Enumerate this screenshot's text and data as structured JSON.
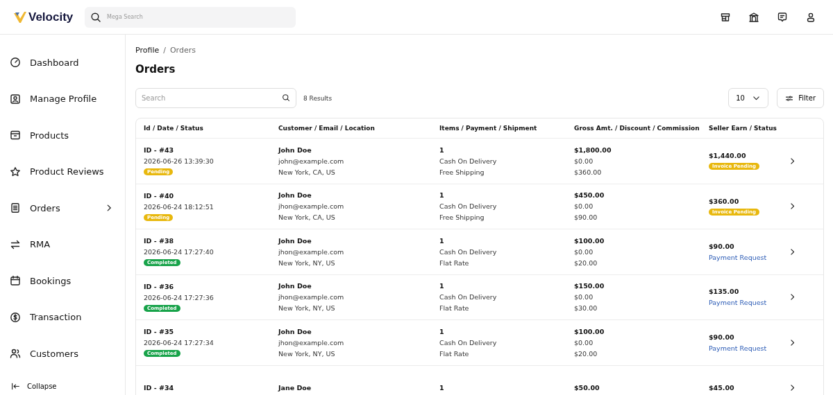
{
  "header": {
    "brand": "Velocity",
    "search": {
      "placeholder": "Mega Search"
    }
  },
  "sidebar": {
    "items": [
      {
        "label": "Dashboard",
        "kind": "link"
      },
      {
        "label": "Manage Profile",
        "kind": "link"
      },
      {
        "label": "Products",
        "kind": "link"
      },
      {
        "label": "Product Reviews",
        "kind": "link"
      },
      {
        "label": "Orders",
        "kind": "group"
      },
      {
        "label": "RMA",
        "kind": "link"
      },
      {
        "label": "Bookings",
        "kind": "link"
      },
      {
        "label": "Transaction",
        "kind": "link"
      },
      {
        "label": "Customers",
        "kind": "link"
      }
    ],
    "collapse": "Collapse"
  },
  "breadcrumb": {
    "items": [
      "Profile",
      "Orders"
    ],
    "separator": "/"
  },
  "title": "Orders",
  "toolbar": {
    "search": {
      "placeholder": "Search"
    },
    "results": "8 Results",
    "per_page": "10",
    "filter": "Filter"
  },
  "table": {
    "columns": [
      "Id / Date / Status",
      "Customer / Email / Location",
      "Items / Payment / Shipment",
      "Gross Amt. / Discount / Commission",
      "Seller Earn / Status"
    ],
    "rows": [
      {
        "id": "ID - #43",
        "date": "2026-06-26 13:39:30",
        "status": {
          "kind": "pending",
          "label": "Pending"
        },
        "customer": "John Doe",
        "email": "john@example.com",
        "location": "New York, CA, US",
        "items": "1",
        "payment": "Cash On Delivery",
        "shipment": "Free Shipping",
        "gross": "$1,800.00",
        "discount": "$0.00",
        "commission": "$360.00",
        "earn": "$1,440.00",
        "earn_status": {
          "kind": "badge",
          "label": "Invoice Pending"
        }
      },
      {
        "id": "ID - #40",
        "date": "2026-06-24 18:12:51",
        "status": {
          "kind": "pending",
          "label": "Pending"
        },
        "customer": "John Doe",
        "email": "jhon@example.com",
        "location": "New York, CA, US",
        "items": "1",
        "payment": "Cash On Delivery",
        "shipment": "Free Shipping",
        "gross": "$450.00",
        "discount": "$0.00",
        "commission": "$90.00",
        "earn": "$360.00",
        "earn_status": {
          "kind": "badge",
          "label": "Invoice Pending"
        }
      },
      {
        "id": "ID - #38",
        "date": "2026-06-24 17:27:40",
        "status": {
          "kind": "completed",
          "label": "Completed"
        },
        "customer": "John Doe",
        "email": "jhon@example.com",
        "location": "New York, NY, US",
        "items": "1",
        "payment": "Cash On Delivery",
        "shipment": "Flat Rate",
        "gross": "$100.00",
        "discount": "$0.00",
        "commission": "$20.00",
        "earn": "$90.00",
        "earn_status": {
          "kind": "link",
          "label": "Payment Request"
        }
      },
      {
        "id": "ID - #36",
        "date": "2026-06-24 17:27:36",
        "status": {
          "kind": "completed",
          "label": "Completed"
        },
        "customer": "John Doe",
        "email": "jhon@example.com",
        "location": "New York, NY, US",
        "items": "1",
        "payment": "Cash On Delivery",
        "shipment": "Flat Rate",
        "gross": "$150.00",
        "discount": "$0.00",
        "commission": "$30.00",
        "earn": "$135.00",
        "earn_status": {
          "kind": "link",
          "label": "Payment Request"
        }
      },
      {
        "id": "ID - #35",
        "date": "2026-06-24 17:27:34",
        "status": {
          "kind": "completed",
          "label": "Completed"
        },
        "customer": "John Doe",
        "email": "jhon@example.com",
        "location": "New York, NY, US",
        "items": "1",
        "payment": "Cash On Delivery",
        "shipment": "Flat Rate",
        "gross": "$100.00",
        "discount": "$0.00",
        "commission": "$20.00",
        "earn": "$90.00",
        "earn_status": {
          "kind": "link",
          "label": "Payment Request"
        }
      },
      {
        "id": "ID - #34",
        "customer": "Jane Doe",
        "items": "1",
        "gross": "$50.00",
        "earn": "$45.00"
      }
    ]
  }
}
